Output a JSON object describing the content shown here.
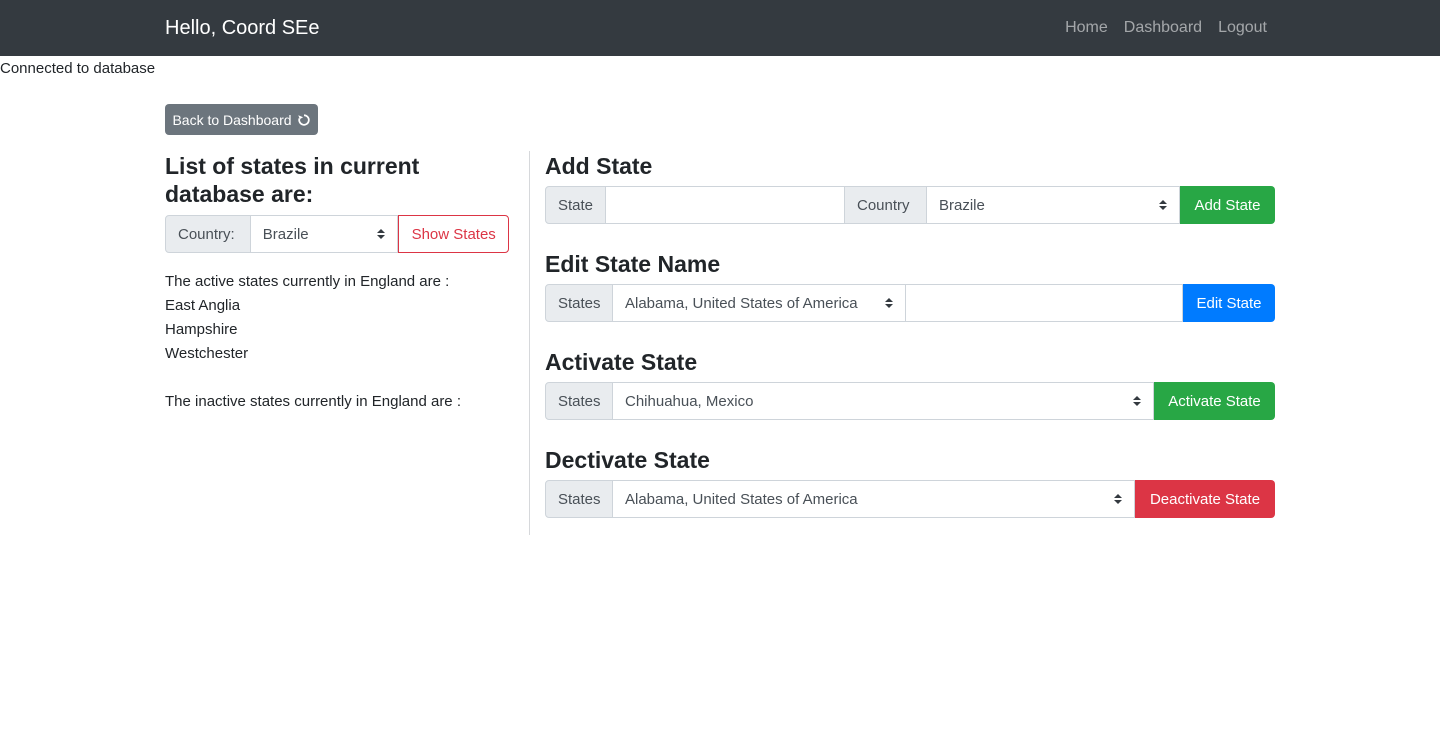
{
  "navbar": {
    "brand": "Hello, Coord SEe",
    "links": [
      "Home",
      "Dashboard",
      "Logout"
    ]
  },
  "status_text": "Connected to database",
  "back_button": {
    "label": "Back to Dashboard",
    "icon": "undo-icon"
  },
  "left": {
    "heading": "List of states in current database are:",
    "country_label": "Country:",
    "country_value": "Brazile",
    "show_button": "Show States",
    "active_intro": "The active states currently in England are :",
    "active_states": [
      "East Anglia",
      "Hampshire",
      "Westchester"
    ],
    "inactive_intro": "The inactive states currently in England are :"
  },
  "add_state": {
    "heading": "Add State",
    "state_label": "State",
    "state_value": "",
    "country_label": "Country",
    "country_value": "Brazile",
    "button": "Add State"
  },
  "edit_state": {
    "heading": "Edit State Name",
    "states_label": "States",
    "selected": "Alabama, United States of America",
    "new_name": "",
    "button": "Edit State"
  },
  "activate_state": {
    "heading": "Activate State",
    "states_label": "States",
    "selected": "Chihuahua, Mexico",
    "button": "Activate State"
  },
  "deactivate_state": {
    "heading": "Dectivate State",
    "states_label": "States",
    "selected": "Alabama, United States of America",
    "button": "Deactivate State"
  },
  "colors": {
    "navbar": "#343a40",
    "success": "#28a745",
    "primary": "#007bff",
    "danger": "#dc3545",
    "secondary": "#6c757d"
  }
}
